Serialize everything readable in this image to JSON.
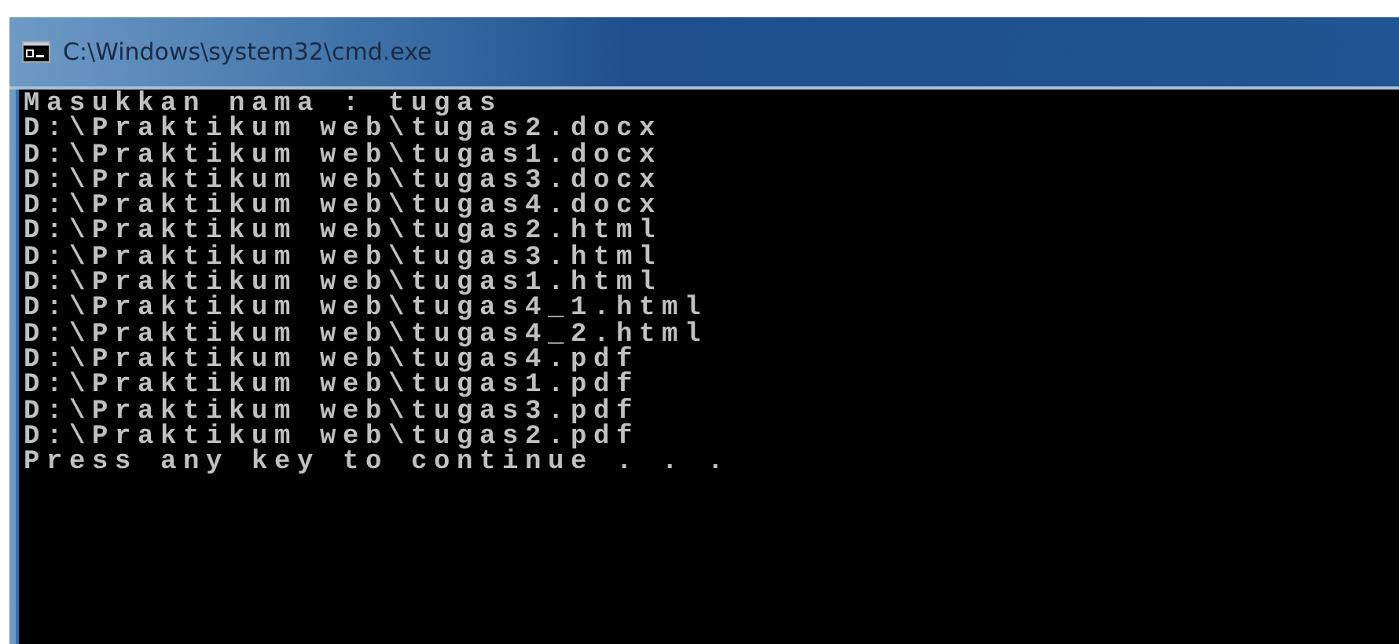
{
  "window": {
    "title": "C:\\Windows\\system32\\cmd.exe"
  },
  "console_lines": [
    "Masukkan nama : tugas",
    "D:\\Praktikum web\\tugas2.docx",
    "D:\\Praktikum web\\tugas1.docx",
    "D:\\Praktikum web\\tugas3.docx",
    "D:\\Praktikum web\\tugas4.docx",
    "D:\\Praktikum web\\tugas2.html",
    "D:\\Praktikum web\\tugas3.html",
    "D:\\Praktikum web\\tugas1.html",
    "D:\\Praktikum web\\tugas4_1.html",
    "D:\\Praktikum web\\tugas4_2.html",
    "D:\\Praktikum web\\tugas4.pdf",
    "D:\\Praktikum web\\tugas1.pdf",
    "D:\\Praktikum web\\tugas3.pdf",
    "D:\\Praktikum web\\tugas2.pdf",
    "Press any key to continue . . ."
  ]
}
